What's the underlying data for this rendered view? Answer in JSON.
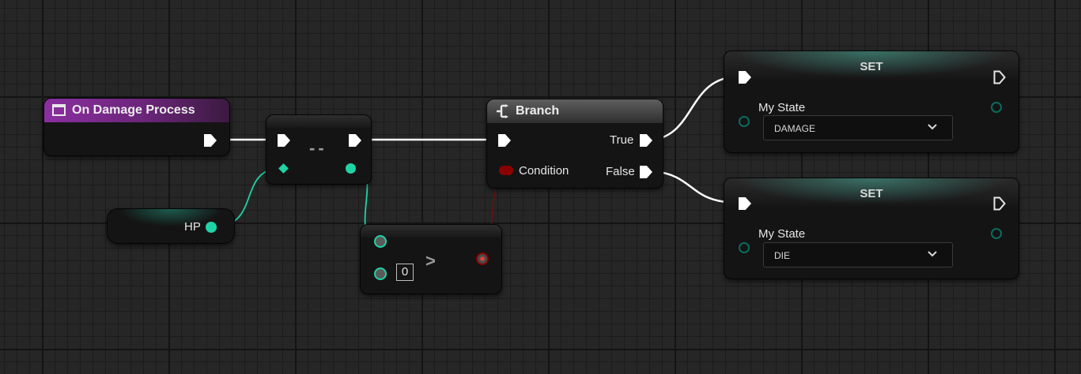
{
  "event_node": {
    "title": "On Damage Process",
    "color": "#7a2a8a"
  },
  "decrement_node": {
    "symbol": "--"
  },
  "variable_node": {
    "label": "HP"
  },
  "compare_node": {
    "symbol": ">",
    "input_value": "0"
  },
  "branch_node": {
    "title": "Branch",
    "condition_label": "Condition",
    "true_label": "True",
    "false_label": "False"
  },
  "set_nodes": [
    {
      "title": "SET",
      "variable_label": "My State",
      "selected": "DAMAGE"
    },
    {
      "title": "SET",
      "variable_label": "My State",
      "selected": "DIE"
    }
  ],
  "colors": {
    "integer_pin": "#1fd3a7",
    "boolean_pin": "#8b0000",
    "enum_pin": "#0b6b5e",
    "exec": "#ffffff"
  }
}
